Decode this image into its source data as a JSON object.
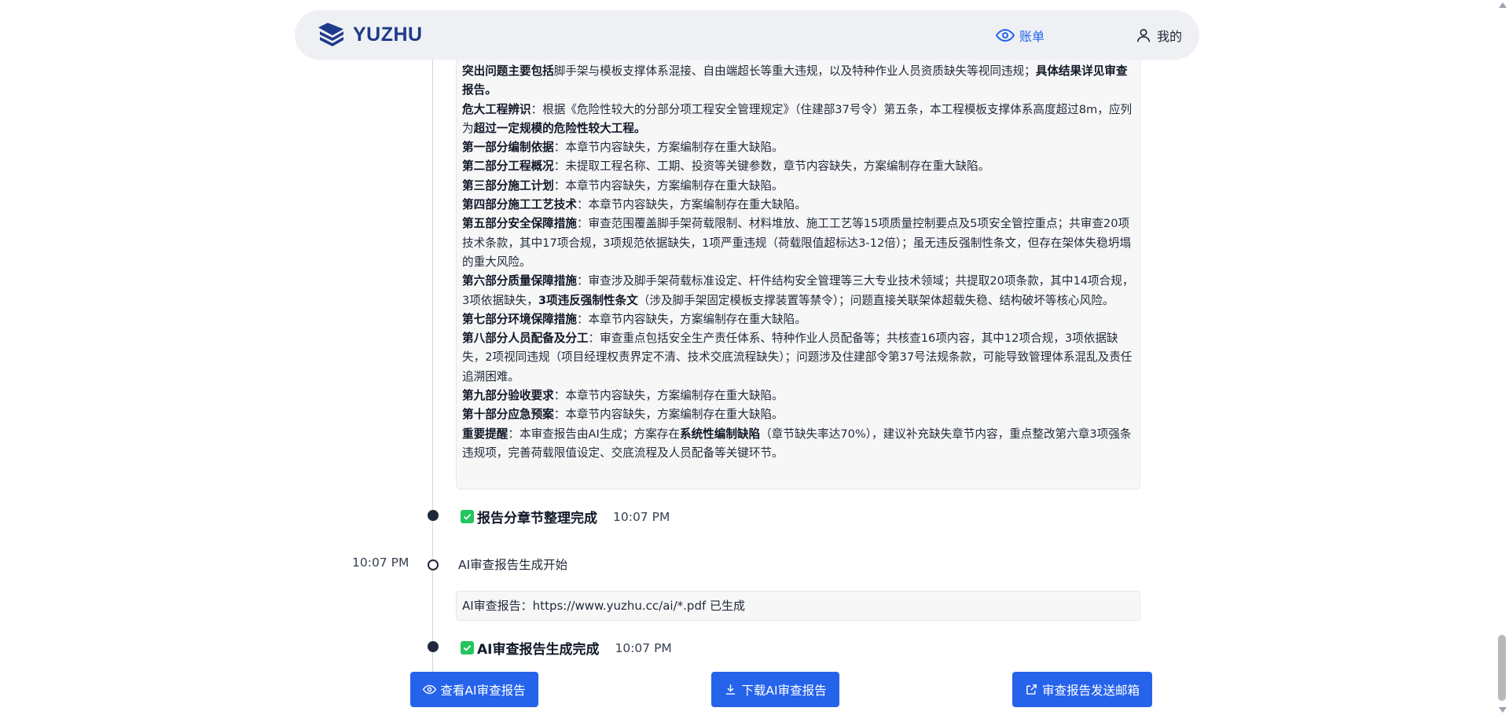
{
  "header": {
    "brand": "YUZHU",
    "nav_bill": "账单",
    "nav_mine": "我的"
  },
  "summary": [
    [
      {
        "t": "突出问题主要包括",
        "b": true
      },
      {
        "t": "脚手架与模板支撑体系混接、自由端超长等重大违规，以及特种作业人员资质缺失等视同违规；"
      },
      {
        "t": "具体结果详见审查报告。",
        "b": true
      }
    ],
    [
      {
        "t": "危大工程辨识",
        "b": true
      },
      {
        "t": "：根据《危险性较大的分部分项工程安全管理规定》（住建部37号令）第五条，本工程模板支撑体系高度超过8m，应列为"
      },
      {
        "t": "超过一定规模的危险性较大工程。",
        "b": true
      }
    ],
    [
      {
        "t": "第一部分编制依据",
        "b": true
      },
      {
        "t": "：本章节内容缺失，方案编制存在重大缺陷。"
      }
    ],
    [
      {
        "t": "第二部分工程概况",
        "b": true
      },
      {
        "t": "：未提取工程名称、工期、投资等关键参数，章节内容缺失，方案编制存在重大缺陷。"
      }
    ],
    [
      {
        "t": "第三部分施工计划",
        "b": true
      },
      {
        "t": "：本章节内容缺失，方案编制存在重大缺陷。"
      }
    ],
    [
      {
        "t": "第四部分施工工艺技术",
        "b": true
      },
      {
        "t": "：本章节内容缺失，方案编制存在重大缺陷。"
      }
    ],
    [
      {
        "t": "第五部分安全保障措施",
        "b": true
      },
      {
        "t": "：审查范围覆盖脚手架荷载限制、材料堆放、施工工艺等15项质量控制要点及5项安全管控重点；共审查20项技术条款，其中17项合规，3项规范依据缺失，1项严重违规（荷载限值超标达3-12倍）；虽无违反强制性条文，但存在架体失稳坍塌的重大风险。"
      }
    ],
    [
      {
        "t": "第六部分质量保障措施",
        "b": true
      },
      {
        "t": "：审查涉及脚手架荷载标准设定、杆件结构安全管理等三大专业技术领域；共提取20项条款，其中14项合规，3项依据缺失，"
      },
      {
        "t": "3项违反强制性条文",
        "b": true
      },
      {
        "t": "（涉及脚手架固定模板支撑装置等禁令）；问题直接关联架体超载失稳、结构破坏等核心风险。"
      }
    ],
    [
      {
        "t": "第七部分环境保障措施",
        "b": true
      },
      {
        "t": "：本章节内容缺失，方案编制存在重大缺陷。"
      }
    ],
    [
      {
        "t": "第八部分人员配备及分工",
        "b": true
      },
      {
        "t": "：审查重点包括安全生产责任体系、特种作业人员配备等；共核查16项内容，其中12项合规，3项依据缺失，2项视同违规（项目经理权责界定不清、技术交底流程缺失）；问题涉及住建部令第37号法规条款，可能导致管理体系混乱及责任追溯困难。"
      }
    ],
    [
      {
        "t": "第九部分验收要求",
        "b": true
      },
      {
        "t": "：本章节内容缺失，方案编制存在重大缺陷。"
      }
    ],
    [
      {
        "t": "第十部分应急预案",
        "b": true
      },
      {
        "t": "：本章节内容缺失，方案编制存在重大缺陷。"
      }
    ],
    [
      {
        "t": "重要提醒",
        "b": true
      },
      {
        "t": "：本审查报告由AI生成；方案存在"
      },
      {
        "t": "系统性编制缺陷",
        "b": true
      },
      {
        "t": "（章节缺失率达70%），建议补充缺失章节内容，重点整改第六章3项强条违规项，完善荷载限值设定、交底流程及人员配备等关键环节。"
      }
    ]
  ],
  "timeline": {
    "step1_title": "报告分章节整理完成",
    "step1_time": "10:07 PM",
    "start_time": "10:07 PM",
    "start_text": "AI审查报告生成开始",
    "link_text": "AI审查报告：https://www.yuzhu.cc/ai/*.pdf 已生成",
    "step2_title": "AI审查报告生成完成",
    "step2_time": "10:07 PM"
  },
  "buttons": {
    "view": "查看AI审查报告",
    "download": "下载AI审查报告",
    "email": "审查报告发送邮箱"
  },
  "colors": {
    "primary": "#2563eb",
    "brand": "#1e3a8a",
    "check": "#22c55e"
  }
}
